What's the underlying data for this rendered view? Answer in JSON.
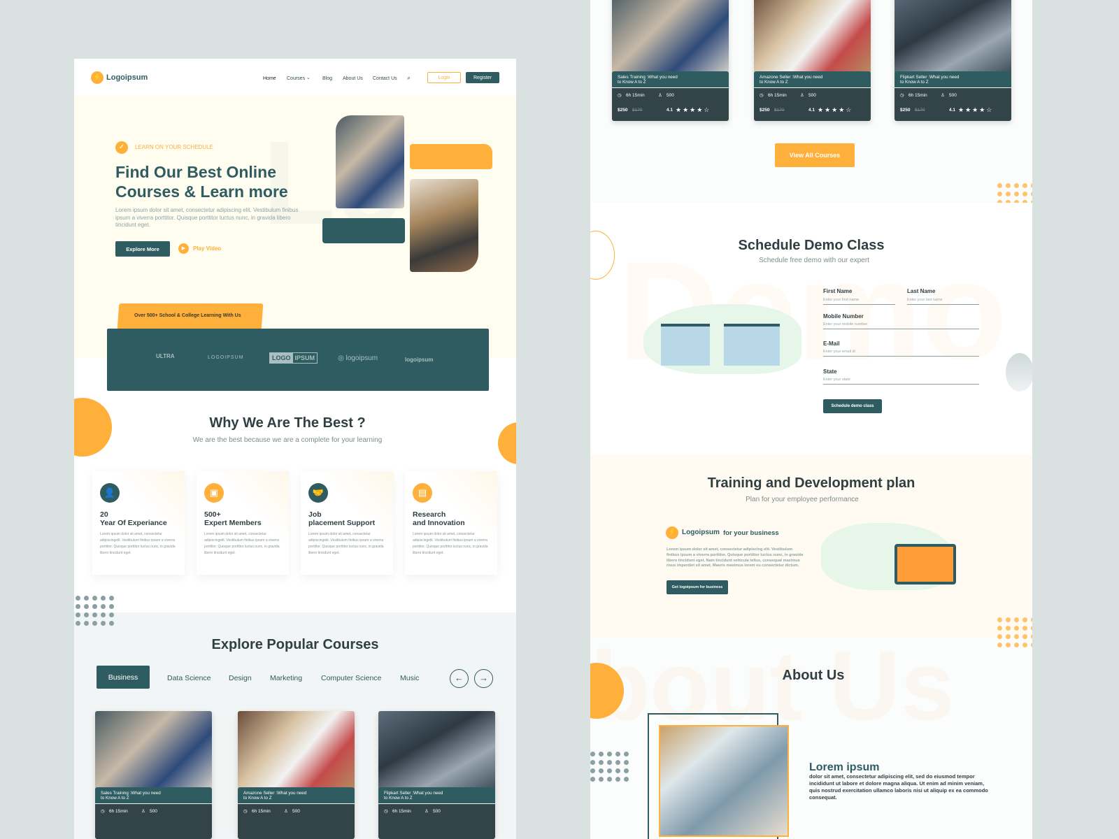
{
  "brand": {
    "name": "Logoipsum",
    "accent": "#ffb03a",
    "primary": "#2f5c60"
  },
  "nav": {
    "items": [
      "Home",
      "Courses",
      "Blog",
      "About Us",
      "Contact Us"
    ],
    "login": "Login",
    "register": "Register"
  },
  "hero": {
    "eyebrow": "LEARN ON YOUR SCHEDULE",
    "title_line1": "Find Our Best Online",
    "title_line2": "Courses & Learn more",
    "body": "Lorem ipsum dolor sit amet, consectetur adipiscing elit. Vestibulum finibus ipsum a viverra porttitor. Quisque porttitor luctus nunc, in gravida libero tincidunt eget.",
    "explore": "Explore More",
    "play": "Play Video"
  },
  "partners": {
    "tag": "Over 500+ School & College Learning With Us",
    "logos": [
      "ULTRA",
      "LOGOIPSUM",
      "LOGO",
      "IPSUM",
      "logoipsum",
      "logoipsum"
    ]
  },
  "why": {
    "title": "Why We Are The Best ?",
    "subtitle": "We are the best because we are a complete for your learning",
    "cards": [
      {
        "line1": "20",
        "line2": "Year Of Experiance",
        "icon": "teacher-icon",
        "body": "Lorem ipsum dolor sit amet, consectetur adipiscingelit. Vestibulum finibus ipsum a viverra porttitor. Quisque porttitor luctus nunc, in gravida libero tincidunt eget."
      },
      {
        "line1": "500+",
        "line2": "Expert Members",
        "icon": "presenter-icon",
        "body": "Lorem ipsum dolor sit amet, consectetur adipiscingelit. Vestibulum finibus ipsum a viverra porttitor. Quisque porttitor luctus nunc, in gravida libero tincidunt eget."
      },
      {
        "line1": "Job",
        "line2": "placement Support",
        "icon": "handshake-icon",
        "body": "Lorem ipsum dolor sit amet, consectetur adipiscingelit. Vestibulum finibus ipsum a viverra porttitor. Quisque porttitor luctus nunc, in gravida libero tincidunt eget."
      },
      {
        "line1": "Research",
        "line2": "and Innovation",
        "icon": "document-search-icon",
        "body": "Lorem ipsum dolor sit amet, consectetur adipiscingelit. Vestibulum finibus ipsum a viverra porttitor. Quisque porttitor luctus nunc, in gravida libero tincidunt eget."
      }
    ]
  },
  "popular": {
    "title": "Explore Popular Courses",
    "tabs": [
      "Business",
      "Data Science",
      "Design",
      "Marketing",
      "Computer Science",
      "Music"
    ],
    "active_tab": "Business"
  },
  "courses": [
    {
      "title1": "Sales Training :What you need",
      "title2": "to Know A to Z",
      "duration": "6h 15min",
      "students": "500",
      "price": "$250",
      "old_price": "$170",
      "rating": "4.1"
    },
    {
      "title1": "Amazone Seller :What you need",
      "title2": "to Know A to Z",
      "duration": "6h 15min",
      "students": "500",
      "price": "$250",
      "old_price": "$170",
      "rating": "4.1"
    },
    {
      "title1": "Flipkart Seller :What you need",
      "title2": "to Know A to Z",
      "duration": "6h 15min",
      "students": "500",
      "price": "$250",
      "old_price": "$170",
      "rating": "4.1"
    }
  ],
  "view_all": "View All Courses",
  "demo": {
    "title": "Schedule Demo Class",
    "subtitle": "Schedule free demo with our expert",
    "watermark": "Demo",
    "first_name": {
      "label": "First Name",
      "placeholder": "Enter your first name"
    },
    "last_name": {
      "label": "Last Name",
      "placeholder": "Enter your last name"
    },
    "mobile": {
      "label": "Mobile Number",
      "placeholder": "Enter your mobile number"
    },
    "email": {
      "label": "E-Mail",
      "placeholder": "Enter your email id"
    },
    "state": {
      "label": "State",
      "placeholder": "Enter your state"
    },
    "submit": "Schedule demo  class"
  },
  "training": {
    "title": "Training and Development plan",
    "subtitle": "Plan for your employee performance",
    "brand": "Logoipsum",
    "tagline": "for your business",
    "body": "Lorem ipsum dolor sit amet, consectetur adipiscing elit. Vestibulum finibus ipsum a viverra porttitor. Quisque porttitor luctus nunc, in gravida libero tincidunt eget. Nam tincidunt vehicula tellus, consequat maximus risus imperdiet sit amet. Mauris maximus lorem eu consectetur dictum.",
    "cta": "Get logoipsum for business"
  },
  "about": {
    "title": "About Us",
    "watermark": "bout Us",
    "heading": "Lorem ipsum",
    "body": "dolor sit amet, consectetur adipiscing elit, sed do eiusmod tempor incididunt ut labore et dolore magna aliqua. Ut enim ad minim veniam, quis nostrud exercitation ullamco laboris nisi ut aliquip ex ea commodo consequat."
  }
}
